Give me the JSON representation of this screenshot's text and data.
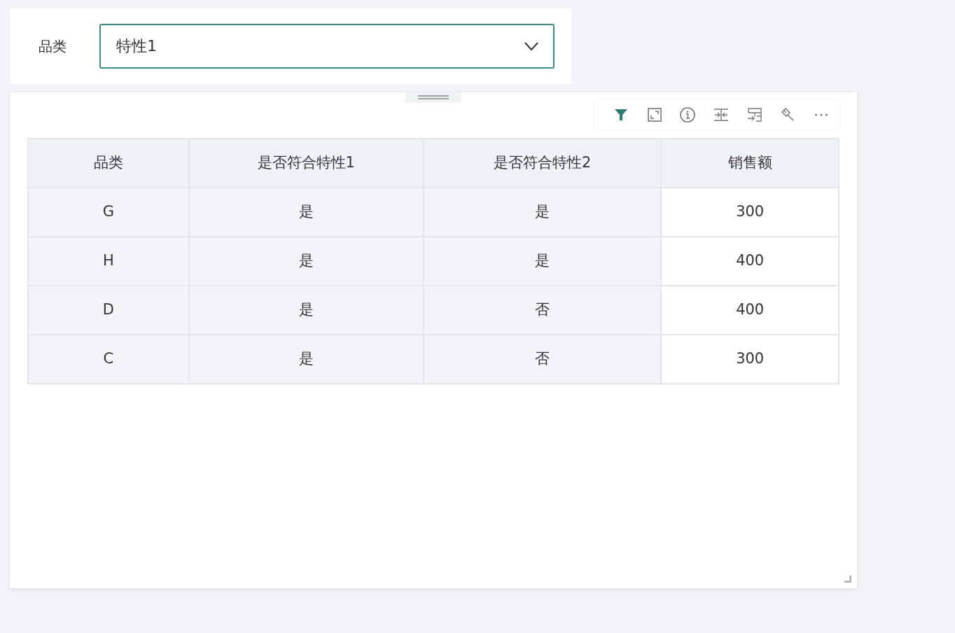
{
  "filter": {
    "label": "品类",
    "value": "特性1"
  },
  "toolbar": [
    {
      "kind": "filter",
      "active": true
    },
    {
      "kind": "expand",
      "active": false
    },
    {
      "kind": "info",
      "active": false
    },
    {
      "kind": "compress",
      "active": false
    },
    {
      "kind": "export",
      "active": false
    },
    {
      "kind": "brush",
      "active": false
    },
    {
      "kind": "more",
      "active": false
    }
  ],
  "table": {
    "columns": [
      {
        "label": "品类",
        "kind": "dimension"
      },
      {
        "label": "是否符合特性1",
        "kind": "dimension"
      },
      {
        "label": "是否符合特性2",
        "kind": "dimension"
      },
      {
        "label": "销售额",
        "kind": "measure"
      }
    ],
    "rows": [
      [
        "G",
        "是",
        "是",
        "300"
      ],
      [
        "H",
        "是",
        "是",
        "400"
      ],
      [
        "D",
        "是",
        "否",
        "400"
      ],
      [
        "C",
        "是",
        "否",
        "300"
      ]
    ]
  }
}
